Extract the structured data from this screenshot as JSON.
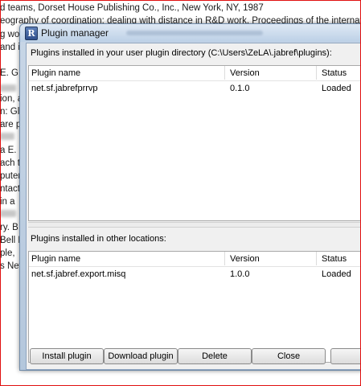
{
  "background": {
    "lines": [
      "d teams, Dorset House Publishing Co., Inc., New York, NY, 1987",
      "eography of coordination: dealing with distance in R&D work. Proceedings of the internation",
      "g wo",
      "and i",
      "E. G",
      "ion, a",
      "n: Gl",
      "are p",
      "a E. C",
      "ach t",
      "puter",
      "ntact",
      "in a",
      "ry. B",
      "Bell L",
      "ple,",
      "s New"
    ]
  },
  "window": {
    "title": "Plugin manager",
    "icon_letter": "R"
  },
  "user_plugins": {
    "section_label": "Plugins installed in your user plugin directory (C:\\Users\\ZeLA\\.jabref\\plugins):",
    "columns": [
      "Plugin name",
      "Version",
      "Status"
    ],
    "rows": [
      {
        "name": "net.sf.jabrefprrvp",
        "version": "0.1.0",
        "status": "Loaded"
      }
    ]
  },
  "other_plugins": {
    "section_label": "Plugins installed in other locations:",
    "columns": [
      "Plugin name",
      "Version",
      "Status"
    ],
    "rows": [
      {
        "name": "net.sf.jabref.export.misq",
        "version": "1.0.0",
        "status": "Loaded"
      }
    ]
  },
  "buttons": {
    "install": "Install plugin",
    "download": "Download plugin",
    "delete": "Delete",
    "close": "Close"
  }
}
